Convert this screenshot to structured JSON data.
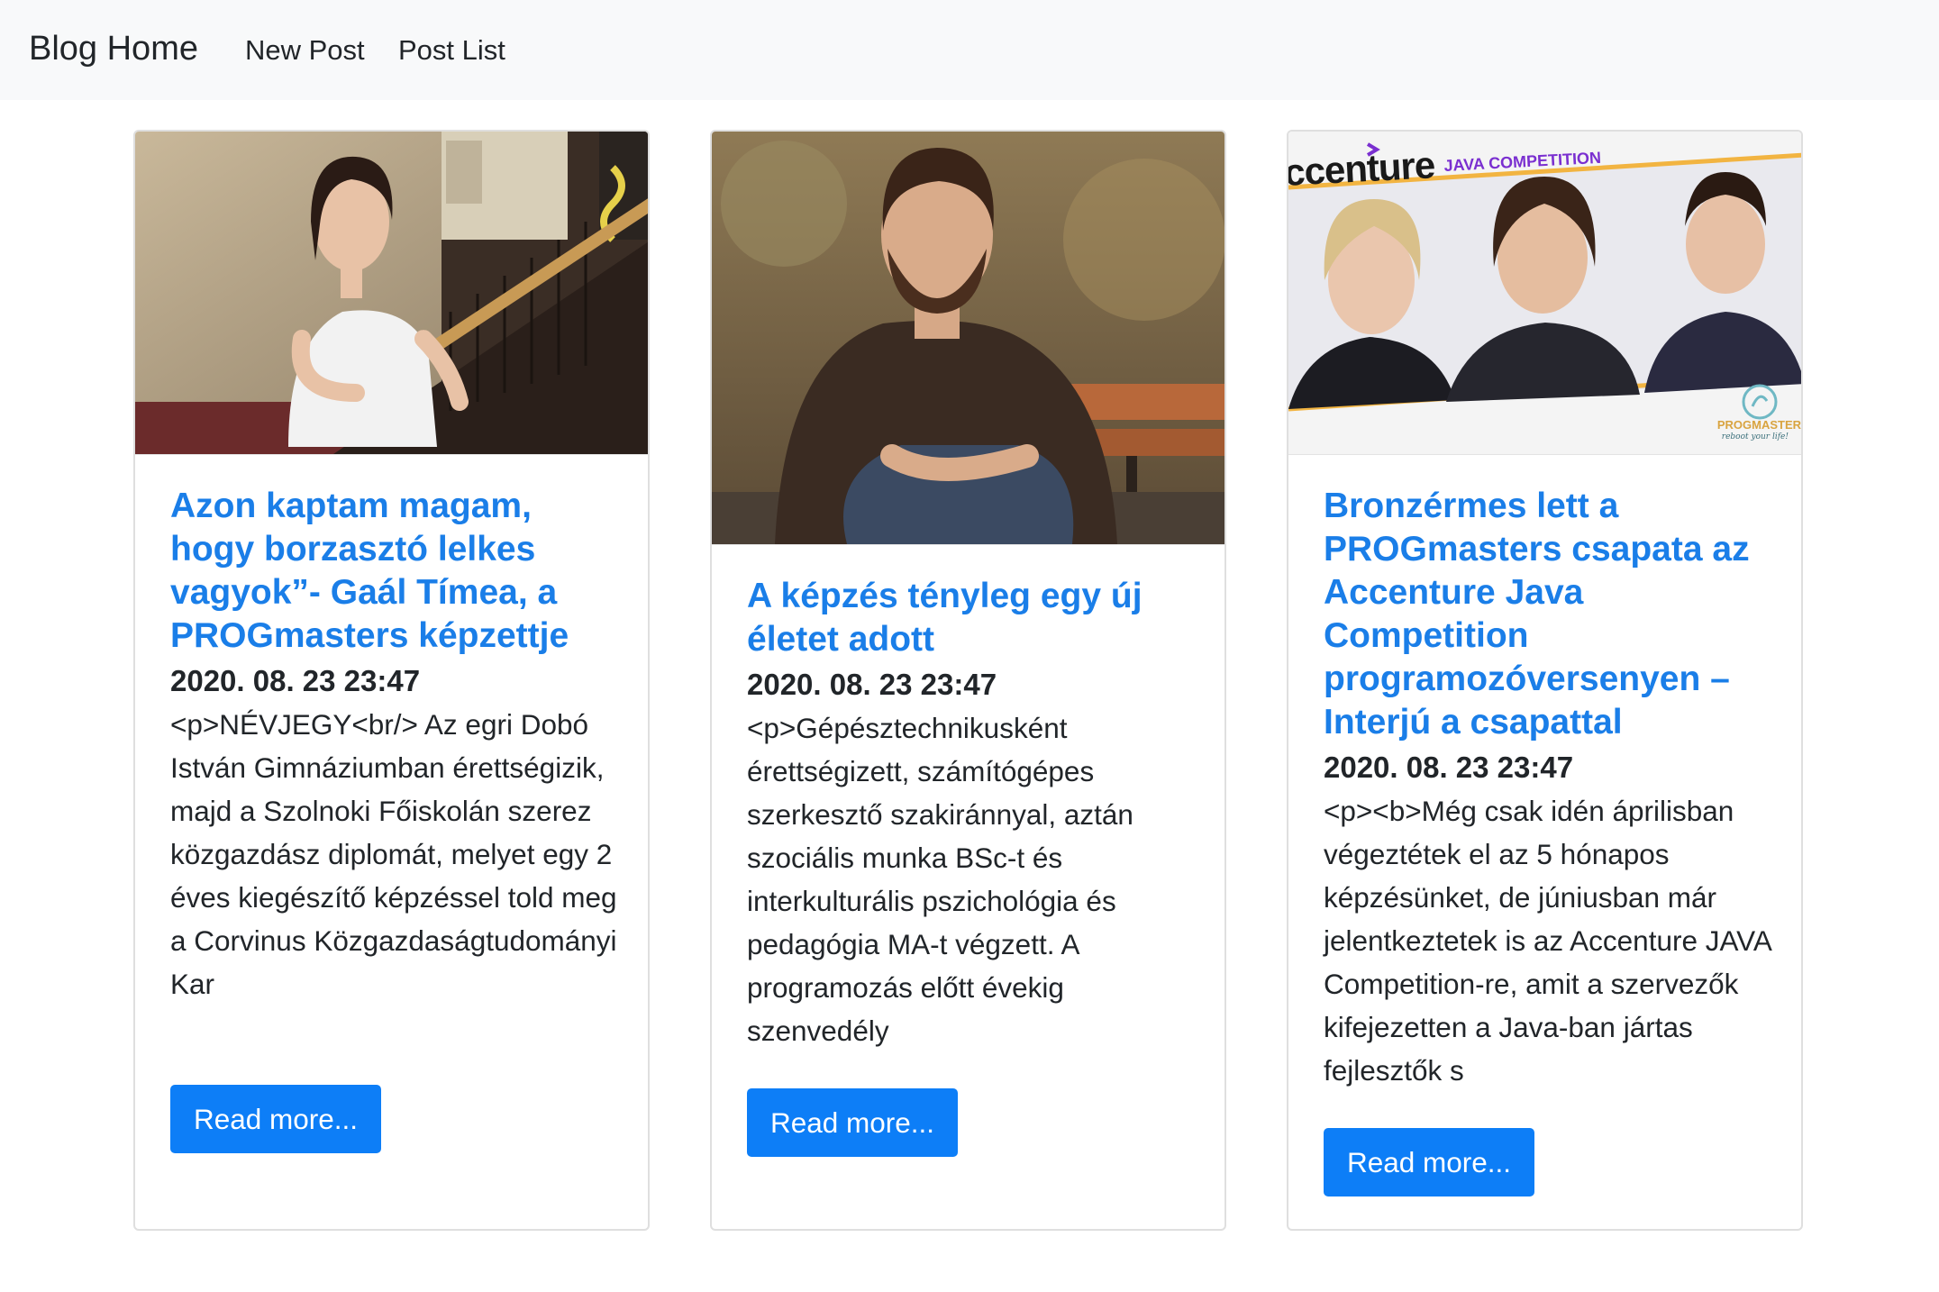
{
  "navbar": {
    "brand": "Blog Home",
    "links": [
      "New Post",
      "Post List"
    ]
  },
  "posts": [
    {
      "title": "Azon kaptam magam, hogy borzasztó lelkes vagyok”- Gaál Tímea, a PROGmasters képzettje",
      "date": "2020. 08. 23 23:47",
      "excerpt": "<p>NÉVJEGY<br/> Az egri Dobó István Gimnáziumban érettségizik, majd a Szolnoki Főiskolán szerez közgazdász diplomát, melyet egy 2 éves kiegészítő képzéssel told meg a Corvinus Közgazdaságtudományi Kar",
      "button": "Read more..."
    },
    {
      "title": "A képzés tényleg egy új életet adott",
      "date": "2020. 08. 23 23:47",
      "excerpt": "<p>Gépésztechnikusként érettségizett, számítógépes szerkesztő szakiránnyal, aztán szociális munka BSc-t és interkulturális pszichológia és pedagógia MA-t végzett. A programozás előtt évekig szenvedély",
      "button": "Read more..."
    },
    {
      "title": "Bronzérmes lett a PROGmasters csapata az Accenture Java Competition programozóversenyen – Interjú a csapattal",
      "date": "2020. 08. 23 23:47",
      "excerpt": "<p><b>Még csak idén áprilisban végeztétek el az 5 hónapos képzésünket, de júniusban már jelentkeztetek is az Accenture JAVA Competition-re, amit a szervezők kifejezetten a Java-ban jártas fejlesztők s",
      "button": "Read more...",
      "banner": {
        "logo": "ccenture",
        "subtitle": "JAVA COMPETITION",
        "partner": "PROGMASTER",
        "tagline": "reboot your life!"
      }
    }
  ],
  "colors": {
    "navbar_bg": "#f8f9fa",
    "link": "#1a7ee8",
    "button": "#0d7ef7",
    "banner_purple": "#7a2fd0",
    "banner_gold": "#f2b441"
  }
}
